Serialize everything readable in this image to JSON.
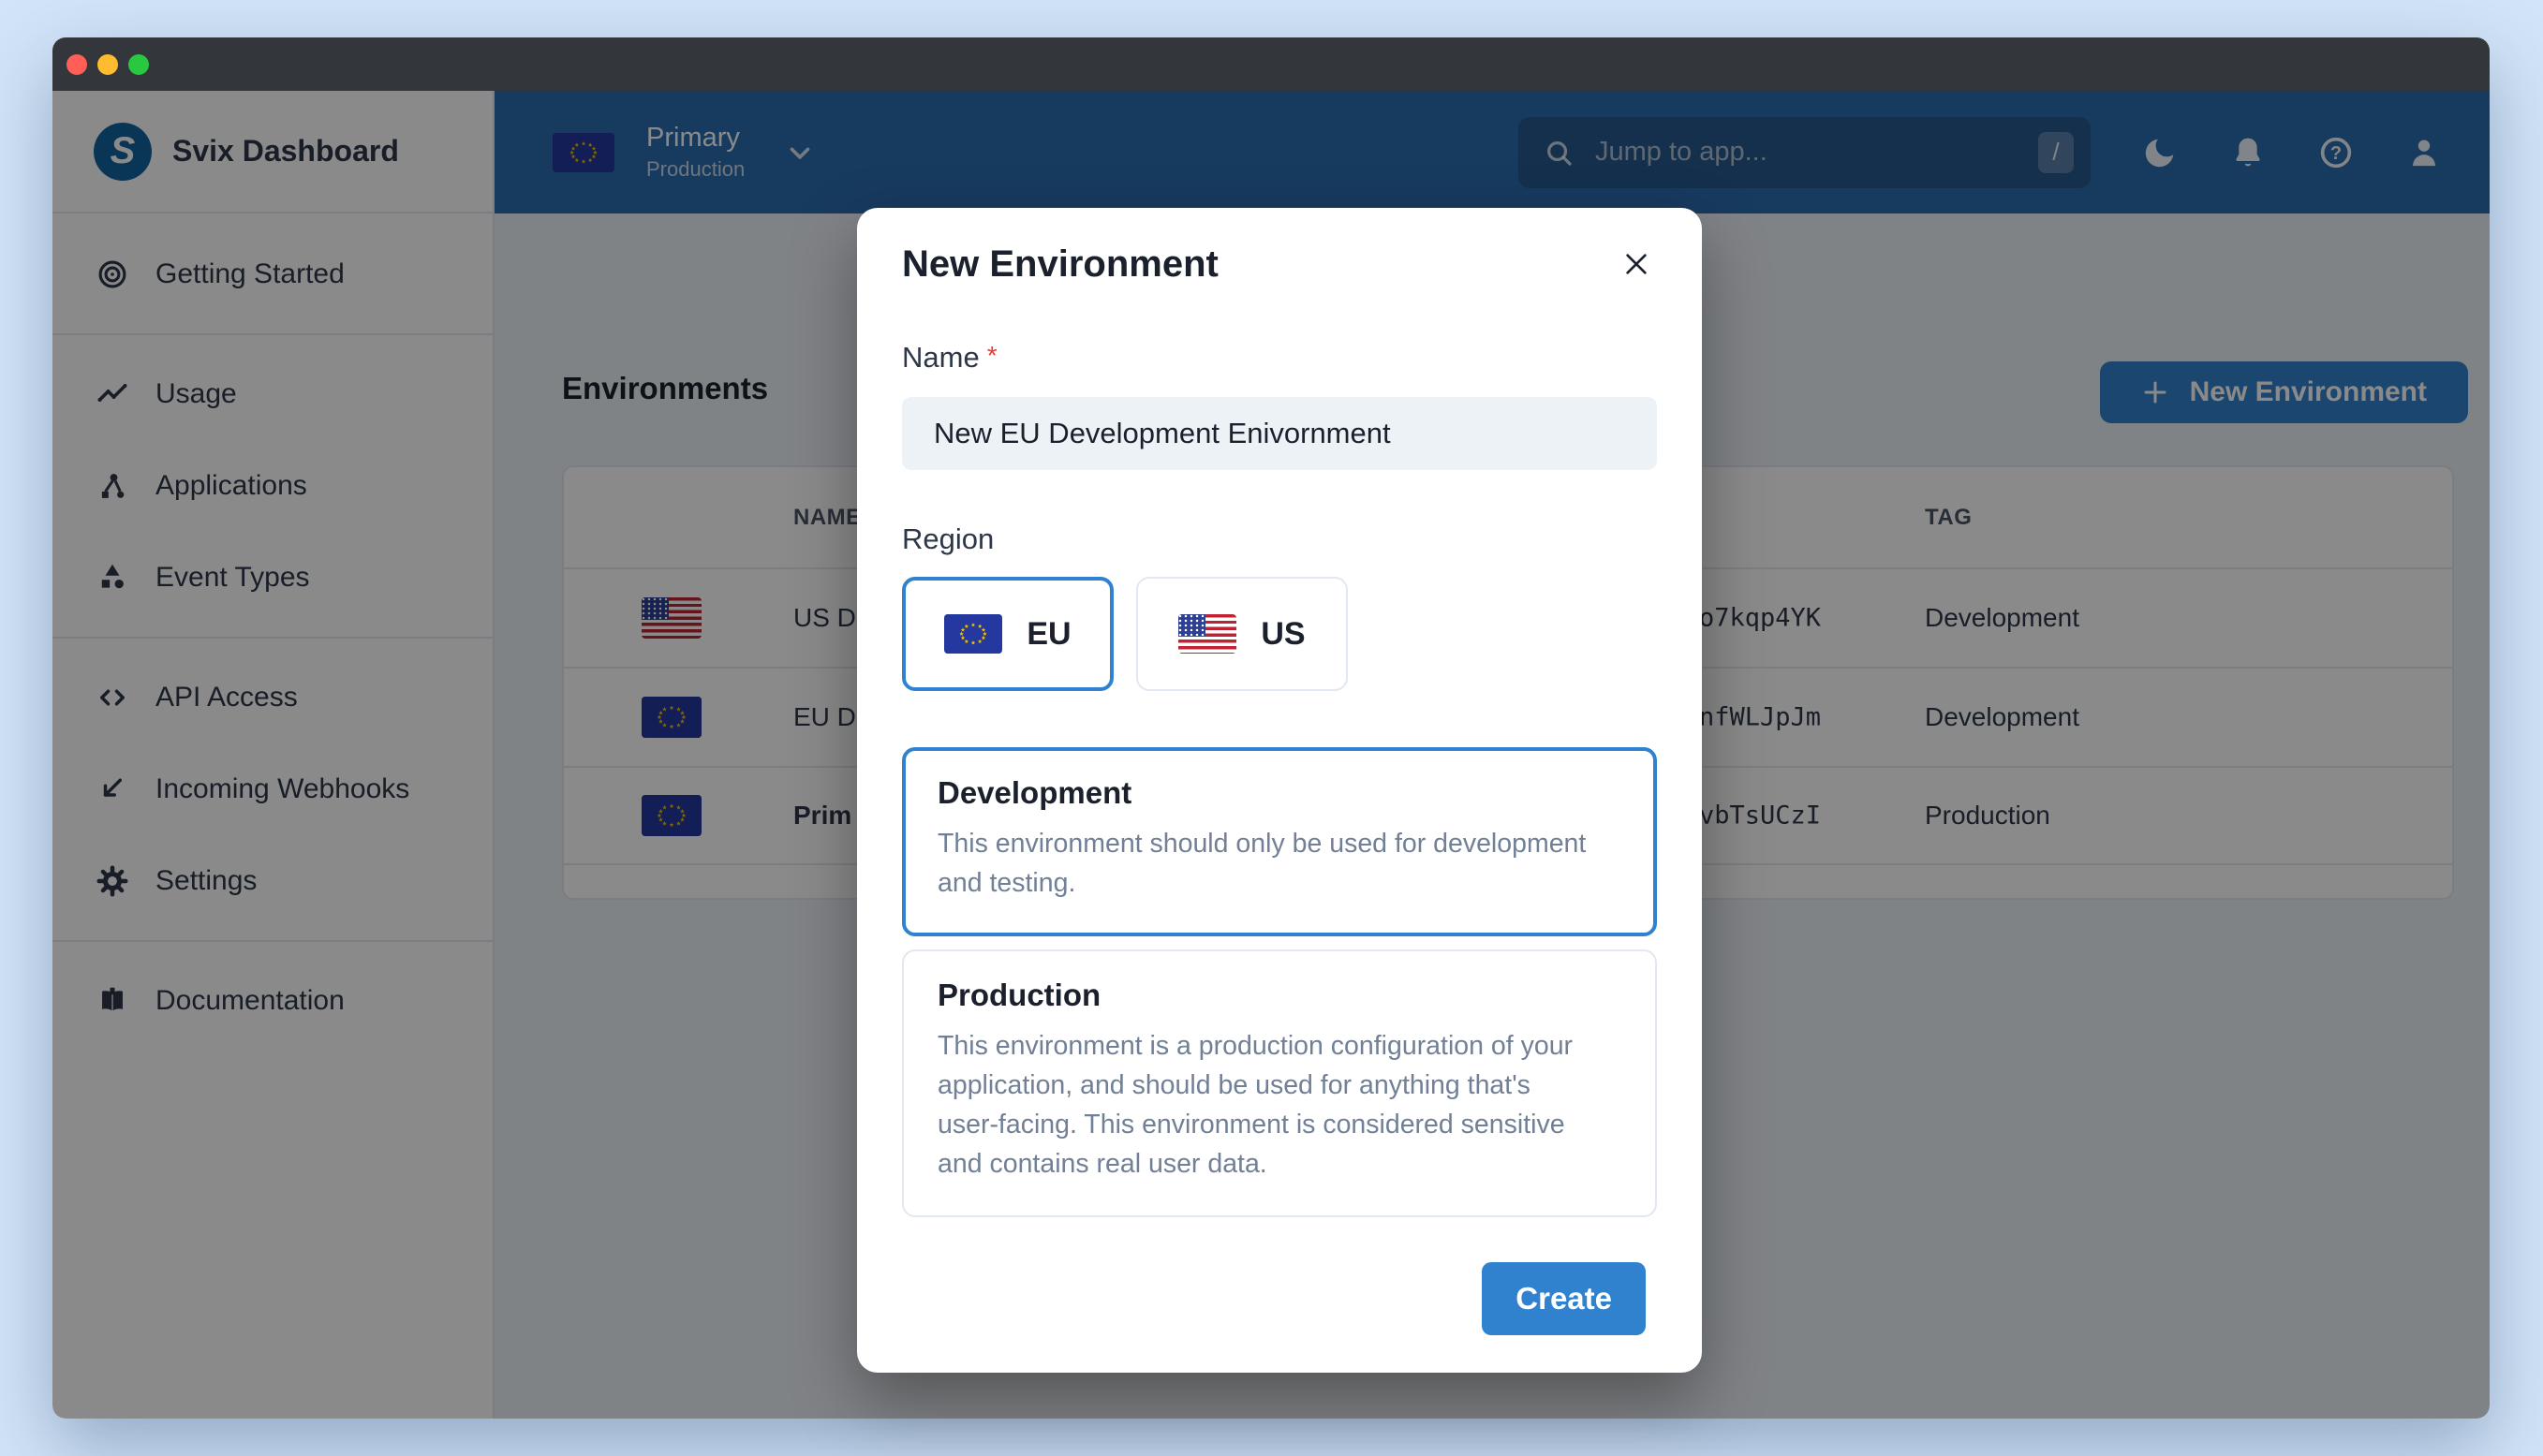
{
  "window": {
    "traffic_lights": [
      "close",
      "minimize",
      "zoom"
    ]
  },
  "sidebar": {
    "brand": "Svix Dashboard",
    "logo_letter": "S",
    "items": [
      {
        "label": "Getting Started",
        "icon": "target-icon"
      },
      {
        "label": "Usage",
        "icon": "trend-icon"
      },
      {
        "label": "Applications",
        "icon": "hierarchy-icon"
      },
      {
        "label": "Event Types",
        "icon": "shapes-icon"
      },
      {
        "label": "API Access",
        "icon": "code-icon"
      },
      {
        "label": "Incoming Webhooks",
        "icon": "arrow-down-left-icon"
      },
      {
        "label": "Settings",
        "icon": "gear-icon"
      },
      {
        "label": "Documentation",
        "icon": "book-icon"
      }
    ]
  },
  "topbar": {
    "environment_switcher": {
      "name": "Primary",
      "tag": "Production",
      "flag": "eu"
    },
    "search": {
      "placeholder": "Jump to app...",
      "shortcut": "/"
    },
    "icons": [
      "moon-icon",
      "bell-icon",
      "help-icon",
      "user-icon"
    ]
  },
  "main": {
    "title": "Environments",
    "new_environment_button": "New Environment",
    "table": {
      "columns": {
        "name": "NAME",
        "tag": "TAG"
      },
      "rows": [
        {
          "flag": "us",
          "name_visible": "US D",
          "id_visible": "o7kqp4YK",
          "tag": "Development",
          "emphasis": false
        },
        {
          "flag": "eu",
          "name_visible": "EU D",
          "id_visible": "nfWLJpJm",
          "tag": "Development",
          "emphasis": false
        },
        {
          "flag": "eu",
          "name_visible": "Prim",
          "id_visible": "vbTsUCzI",
          "tag": "Production",
          "emphasis": true
        }
      ]
    }
  },
  "modal": {
    "title": "New Environment",
    "name_label": "Name",
    "required_marker": "*",
    "name_value": "New EU Development Enivornment",
    "region_label": "Region",
    "regions": [
      {
        "code": "EU",
        "flag": "eu",
        "selected": true
      },
      {
        "code": "US",
        "flag": "us",
        "selected": false
      }
    ],
    "types": [
      {
        "title": "Development",
        "description": "This environment should only be used for development and testing.",
        "selected": true
      },
      {
        "title": "Production",
        "description": "This environment is a production configuration of your application, and should be used for anything that's user-facing. This environment is considered sensitive and contains real user data.",
        "selected": false
      }
    ],
    "create_button": "Create"
  },
  "colors": {
    "accent": "#3182CE",
    "topbar": "#2B6CB0",
    "required": "#E53E3E",
    "page_background": "#d2e4f8",
    "overlay": "rgba(0,0,0,0.46)"
  }
}
